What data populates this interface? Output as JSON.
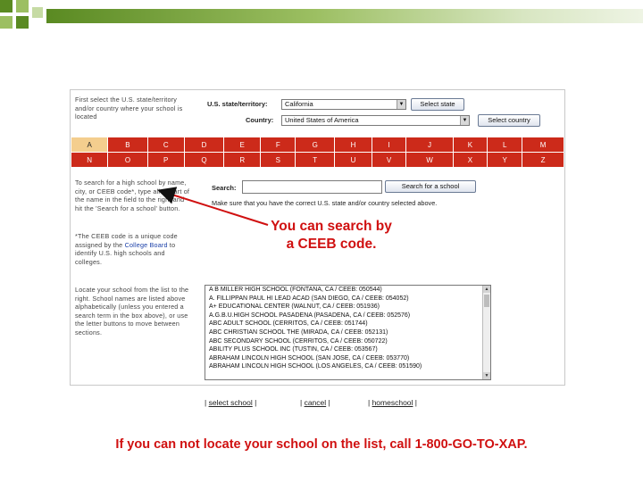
{
  "colors": {
    "accent_red": "#cc2a1a",
    "callout_red": "#d01010",
    "active_letter_bg": "#f4ce8e",
    "deco_green": "#5a8a22"
  },
  "form": {
    "instruction_top": "First select the U.S. state/territory and/or country where your school is located",
    "state_label": "U.S. state/territory:",
    "state_value": "California",
    "select_state_button": "Select state",
    "country_label": "Country:",
    "country_value": "United States of America",
    "select_country_button": "Select country"
  },
  "alphabet": {
    "row1": [
      "A",
      "B",
      "C",
      "D",
      "E",
      "F",
      "G",
      "H",
      "I",
      "J",
      "K",
      "L",
      "M"
    ],
    "row2": [
      "N",
      "O",
      "P",
      "Q",
      "R",
      "S",
      "T",
      "U",
      "V",
      "W",
      "X",
      "Y",
      "Z"
    ]
  },
  "search": {
    "instruction": "To search for a high school by name, city, or CEEB code*, type all or part of the name in the field to the right and hit the 'Search for a school' button.",
    "ceeb_note_pre": "*The CEEB code is a unique code assigned by the",
    "ceeb_note_link": "College Board",
    "ceeb_note_post": "to identify U.S. high schools and colleges.",
    "label": "Search:",
    "input_value": "",
    "button": "Search for a school",
    "note": "Make sure that you have the correct U.S. state and/or country selected above."
  },
  "list": {
    "instruction": "Locate your school from the list to the right. School names are listed above alphabetically (unless you entered a search term in the box above), or use the letter buttons to move between sections.",
    "items": [
      "A B MILLER HIGH SCHOOL  (FONTANA, CA / CEEB: 050544)",
      "A. FILLIPPAN PAUL HI LEAD ACAD  (SAN DIEGO, CA / CEEB: 054052)",
      "A+ EDUCATIONAL CENTER  (WALNUT, CA / CEEB: 051936)",
      "A.G.B.U.HIGH SCHOOL PASADENA  (PASADENA, CA / CEEB: 052576)",
      "ABC ADULT SCHOOL  (CERRITOS, CA / CEEB: 051744)",
      "ABC CHRISTIAN SCHOOL THE  (MIRADA, CA / CEEB: 052131)",
      "ABC SECONDARY SCHOOL  (CERRITOS, CA / CEEB: 050722)",
      "ABILITY PLUS SCHOOL INC  (TUSTIN, CA / CEEB: 053567)",
      "ABRAHAM LINCOLN HIGH SCHOOL  (SAN JOSE, CA / CEEB: 053770)",
      "ABRAHAM LINCOLN HIGH SCHOOL  (LOS ANGELES, CA / CEEB: 051590)"
    ]
  },
  "links": {
    "select_school": "select school",
    "cancel": "cancel",
    "homeschool": "homeschool"
  },
  "callout": {
    "line1": "You can search by",
    "line2": "a CEEB code."
  },
  "footer_text": "If you can not locate your school on the list, call 1-800-GO-TO-XAP."
}
